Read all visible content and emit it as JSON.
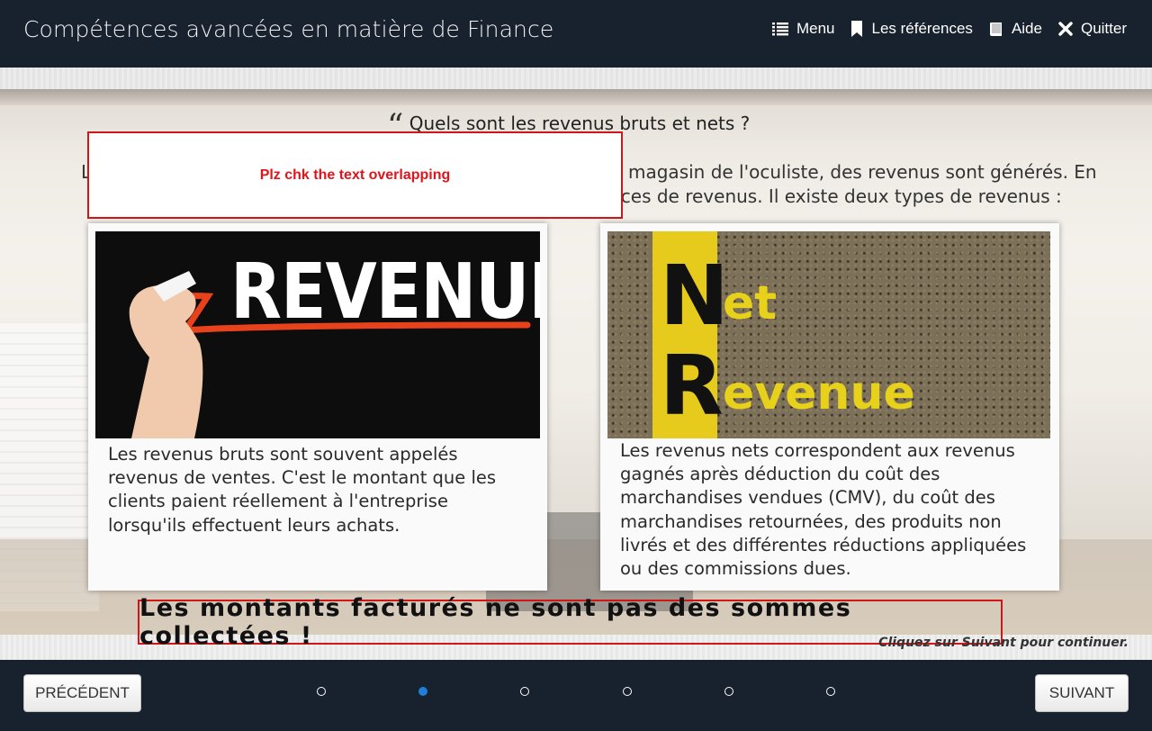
{
  "header": {
    "title": "Compétences avancées en matière de Finance",
    "nav": [
      {
        "label": "Menu",
        "icon": "list-icon"
      },
      {
        "label": "Les références",
        "icon": "bookmark-icon"
      },
      {
        "label": "Aide",
        "icon": "book-icon"
      },
      {
        "label": "Quitter",
        "icon": "close-icon"
      }
    ]
  },
  "slide": {
    "question": "Quels sont les revenus bruts et nets ?",
    "intro_line1_start": "L",
    "intro_line1_end": "magasin de l'oculiste, des revenus sont générés. En",
    "intro_line2_end": "rces de revenus. Il existe deux types de revenus :",
    "review_note": "Plz chk the text overlapping",
    "cards": [
      {
        "image_word": "REVENUE",
        "text": "Les revenus bruts sont souvent appelés revenus de ventes. C'est le montant que les clients paient réellement à l'entreprise lorsqu'ils effectuent leurs achats."
      },
      {
        "image_word_1_initial": "N",
        "image_word_1_rest": "et",
        "image_word_2_initial": "R",
        "image_word_2_rest": "evenue",
        "text": "Les revenus nets correspondent aux revenus gagnés après déduction du coût des marchandises vendues (CMV), du coût des marchandises retournées, des produits non livrés et des différentes réductions appliquées ou des commissions dues."
      }
    ],
    "callout": "Les montants facturés ne sont pas des sommes collectées !",
    "hint": "Cliquez sur Suivant pour continuer."
  },
  "footer": {
    "prev_label": "PRÉCÉDENT",
    "next_label": "SUIVANT",
    "page_count": 6,
    "current_page": 2
  },
  "colors": {
    "header_bg": "#18212e",
    "accent_dot": "#1e7fd8",
    "review_red": "#d01616"
  }
}
